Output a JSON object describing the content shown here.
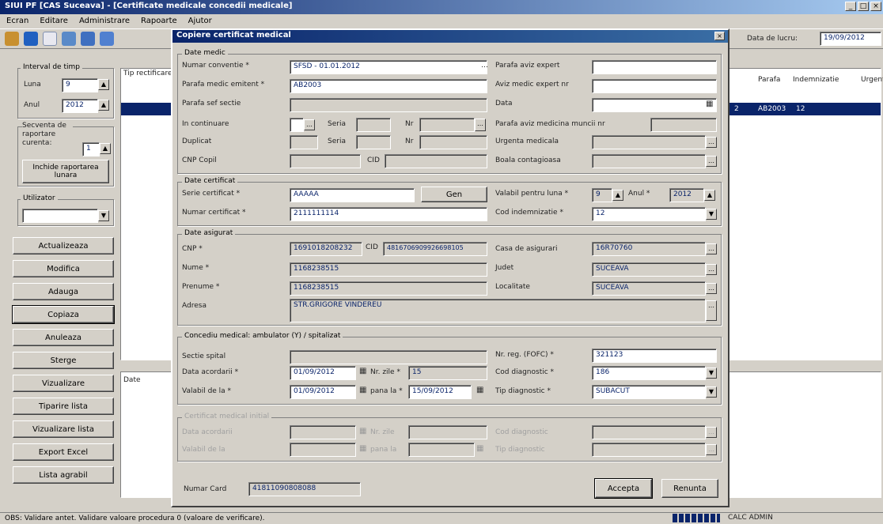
{
  "window": {
    "title": "SIUI PF [CAS Suceava] - [Certificate medicale concedii medicale]"
  },
  "menu": [
    "Ecran",
    "Editare",
    "Administrare",
    "Rapoarte",
    "Ajutor"
  ],
  "toolbar": {
    "date_label": "Data de lucru:",
    "date_value": "19/09/2012"
  },
  "left": {
    "interval_label": "Interval de timp",
    "luna_label": "Luna",
    "luna_value": "9",
    "anul_label": "Anul",
    "anul_value": "2012",
    "secventa_label": "Secventa de raportare curenta:",
    "secventa_value": "1",
    "inchide_btn": "Inchide raportarea lunara",
    "utilizator_label": "Utilizator",
    "buttons": [
      "Actualizeaza",
      "Modifica",
      "Adauga",
      "Copiaza",
      "Anuleaza",
      "Sterge",
      "Vizualizare",
      "Tiparire lista",
      "Vizualizare lista",
      "Export Excel",
      "Lista agrabil"
    ]
  },
  "grid": {
    "col1": "Tip rectificare",
    "cols_right": [
      "Parafa",
      "Indemnizatie",
      "Urgenta"
    ],
    "row_cells": [
      "AB2003",
      "12"
    ],
    "row_prefix": "2",
    "lower_label": "Date"
  },
  "dialog": {
    "title": "Copiere certificat medical",
    "medic": {
      "legend": "Date medic",
      "nr_conv_label": "Numar conventie *",
      "nr_conv_value": "SFSD - 01.01.2012",
      "parafa_label": "Parafa medic emitent *",
      "parafa_value": "AB2003",
      "parafa_sef_label": "Parafa sef sectie",
      "in_cont_label": "In continuare",
      "seria_label": "Seria",
      "nr_label": "Nr",
      "duplicat_label": "Duplicat",
      "cnp_copil_label": "CNP Copil",
      "cid_label": "CID",
      "parafa_av_label": "Parafa aviz expert",
      "aviz_label": "Aviz medic expert nr",
      "data_label": "Data",
      "parafa_av_mc_label": "Parafa aviz medicina muncii nr",
      "urgenta_label": "Urgenta medicala",
      "boala_label": "Boala contagioasa"
    },
    "certificat": {
      "legend": "Date certificat",
      "serie_label": "Serie certificat *",
      "serie_value": "AAAAA",
      "gen_btn": "Gen",
      "numar_label": "Numar certificat *",
      "numar_value": "2111111114",
      "valabil_label": "Valabil pentru luna *",
      "valabil_value": "9",
      "anul_label": "Anul *",
      "anul_value": "2012",
      "cod_ind_label": "Cod indemnizatie *",
      "cod_ind_value": "12"
    },
    "asigurat": {
      "legend": "Date asigurat",
      "cnp_label": "CNP *",
      "cnp_value": "1691018208232",
      "cid_label": "CID",
      "cid_value": "4816706909926698105",
      "nume_label": "Nume *",
      "nume_value": "1168238515",
      "prenume_label": "Prenume *",
      "prenume_value": "1168238515",
      "adresa_label": "Adresa",
      "adresa_value": "STR.GRIGORE VINDEREU",
      "casa_label": "Casa de asigurari",
      "casa_value": "16R70760",
      "judet_label": "Judet",
      "judet_value": "SUCEAVA",
      "localitate_label": "Localitate",
      "localitate_value": "SUCEAVA"
    },
    "concediu": {
      "legend": "Concediu medical: ambulator (Y)  /  spitalizat",
      "sectie_label": "Sectie spital",
      "data_acordarii_label": "Data acordarii *",
      "data_acordarii_value": "01/09/2012",
      "nr_zile_label": "Nr. zile *",
      "nr_zile_value": "15",
      "valabil_label": "Valabil de la *",
      "valabil_value": "01/09/2012",
      "pana_label": "pana la *",
      "pana_value": "15/09/2012",
      "nr_reg_label": "Nr. reg. (FOFC) *",
      "nr_reg_value": "321123",
      "cod_diag_label": "Cod diagnostic *",
      "cod_diag_value": "186",
      "tip_diag_label": "Tip diagnostic *",
      "tip_diag_value": "SUBACUT"
    },
    "initial": {
      "legend": "Certificat medical initial",
      "data_acordarii_label": "Data acordarii",
      "nr_zile_label": "Nr. zile",
      "valabil_label": "Valabil de la",
      "pana_label": "pana la",
      "cod_diag_label": "Cod diagnostic",
      "tip_diag_label": "Tip diagnostic"
    },
    "card": {
      "label": "Numar Card",
      "value": "41811090808088"
    },
    "accept_btn": "Accepta",
    "renunt_btn": "Renunta"
  },
  "status": {
    "text": "OBS: Validare antet. Validare valoare procedura 0 (valoare de verificare).",
    "right": "CALC    ADMIN"
  }
}
